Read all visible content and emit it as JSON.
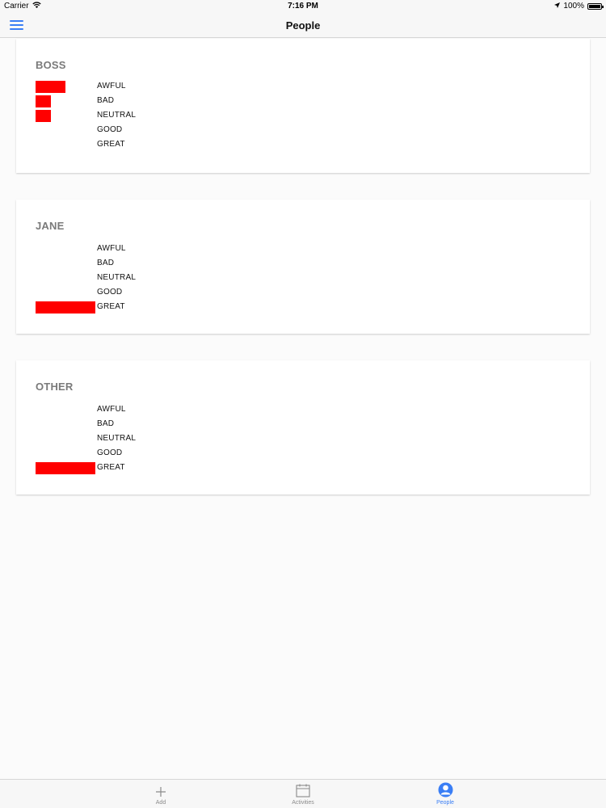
{
  "status_bar": {
    "carrier": "Carrier",
    "time": "7:16 PM",
    "battery": "100%"
  },
  "nav": {
    "title": "People"
  },
  "cards": [
    {
      "name": "BOSS",
      "rows": [
        {
          "label": "AWFUL",
          "value": 2
        },
        {
          "label": "BAD",
          "value": 1
        },
        {
          "label": "NEUTRAL",
          "value": 1
        },
        {
          "label": "GOOD",
          "value": 0
        },
        {
          "label": "GREAT",
          "value": 0
        }
      ]
    },
    {
      "name": "JANE",
      "rows": [
        {
          "label": "AWFUL",
          "value": 0
        },
        {
          "label": "BAD",
          "value": 0
        },
        {
          "label": "NEUTRAL",
          "value": 0
        },
        {
          "label": "GOOD",
          "value": 0
        },
        {
          "label": "GREAT",
          "value": 4
        }
      ]
    },
    {
      "name": "OTHER",
      "rows": [
        {
          "label": "AWFUL",
          "value": 0
        },
        {
          "label": "BAD",
          "value": 0
        },
        {
          "label": "NEUTRAL",
          "value": 0
        },
        {
          "label": "GOOD",
          "value": 0
        },
        {
          "label": "GREAT",
          "value": 4
        }
      ]
    }
  ],
  "bar_color": "#ff0000",
  "tabs": [
    {
      "label": "Add",
      "icon": "plus-icon",
      "active": false
    },
    {
      "label": "Activities",
      "icon": "calendar-icon",
      "active": false
    },
    {
      "label": "People",
      "icon": "person-icon",
      "active": true
    }
  ],
  "accent_color": "#3a7ef5"
}
